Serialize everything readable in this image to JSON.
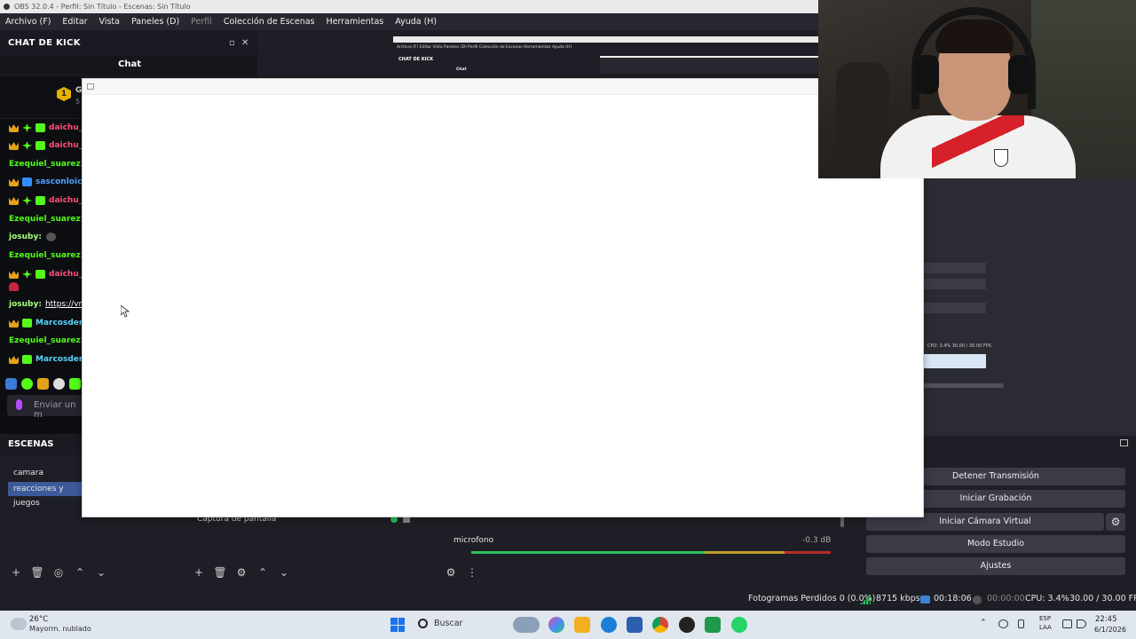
{
  "window": {
    "title": "OBS 32.0.4 - Perfil: Sin Título - Escenas: Sin Título"
  },
  "menu": {
    "items": [
      "Archivo (F)",
      "Editar",
      "Vista",
      "Paneles (D)",
      "Perfil",
      "Colección de Escenas",
      "Herramientas",
      "Ayuda (H)"
    ]
  },
  "chat_dock": {
    "title": "CHAT DE KICK",
    "tab": "Chat",
    "pinned_initial": "G",
    "pinned_sub": "5",
    "messages": [
      {
        "user": "daichu_c",
        "color": "pink"
      },
      {
        "user": "daichu_c",
        "color": "pink"
      },
      {
        "user": "Ezequiel_suarez10:",
        "color": "green"
      },
      {
        "user": "sasconloich",
        "color": "blue"
      },
      {
        "user": "daichu_c",
        "color": "pink"
      },
      {
        "user": "Ezequiel_suarez10:",
        "color": "green"
      },
      {
        "user": "josuby:",
        "color": "lgreen"
      },
      {
        "user": "Ezequiel_suarez10:",
        "color": "green"
      },
      {
        "user": "daichu_c",
        "color": "pink"
      },
      {
        "user": "josuby:",
        "color": "lgreen",
        "link": "https://vm.t"
      },
      {
        "user": "Marcosdemi",
        "color": "cyan"
      },
      {
        "user": "Ezequiel_suarez10:",
        "color": "green"
      },
      {
        "user": "Marcosdemi",
        "color": "cyan"
      }
    ],
    "input_placeholder": "Enviar un m"
  },
  "scenes": {
    "header": "ESCENAS",
    "items": [
      "camara",
      "reacciones y juegos"
    ],
    "active_index": 1
  },
  "sources": {
    "visible_item": "Captura de pantalla"
  },
  "mixer": {
    "channel": "microfono",
    "level": "-0.3 dB"
  },
  "controls": {
    "buttons": [
      "Detener Transmisión",
      "Iniciar Grabación",
      "Iniciar Cámara Virtual",
      "Modo Estudio",
      "Ajustes"
    ]
  },
  "status": {
    "dropped": "Fotogramas Perdidos 0 (0.0%)",
    "bitrate": "8715 kbps",
    "stream_time": "00:18:06",
    "rec_time": "00:00:00",
    "cpu": "CPU: 3.4%",
    "fps": "30.00 / 30.00 FPS"
  },
  "taskbar": {
    "temp": "26°C",
    "weather": "Mayorm. nublado",
    "search": "Buscar",
    "lang1": "ESP",
    "lang2": "LAA",
    "time": "22:45",
    "date": "6/1/2026"
  },
  "preview": {
    "mini_menu": "Archivo (F)   Editar   Vista   Paneles (D)   Perfil   Colección de Escenas   Herramientas   Ayuda (H)",
    "mini_chat_title": "CHAT DE KICK",
    "mini_chat_tab": "Chat"
  },
  "right_dock": {
    "mini_stats": "CPU: 3.4%   30.00 / 30.00 FPS"
  },
  "colors": {
    "accent": "#3c5a99",
    "kick_green": "#53fc18"
  }
}
